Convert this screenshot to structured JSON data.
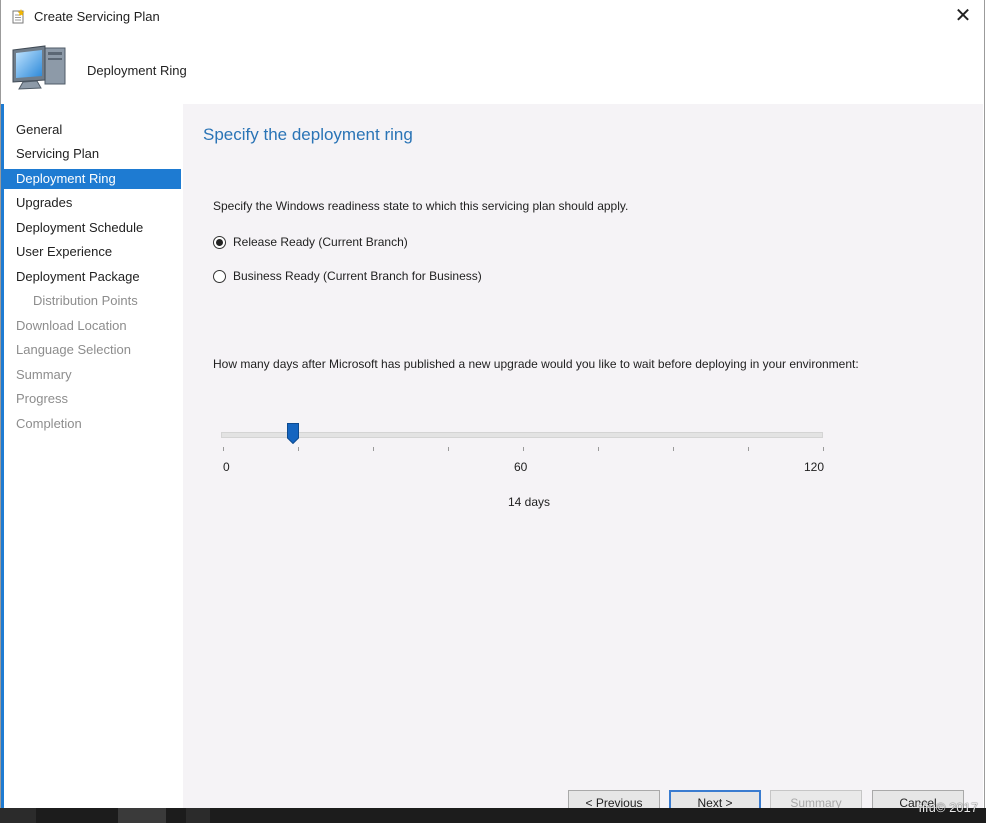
{
  "window": {
    "title": "Create Servicing Plan",
    "close_glyph": "✕"
  },
  "header": {
    "page_name": "Deployment Ring",
    "icon": "computer-monitor-icon"
  },
  "sidebar": {
    "items": [
      {
        "label": "General",
        "state": "normal"
      },
      {
        "label": "Servicing Plan",
        "state": "normal"
      },
      {
        "label": "Deployment Ring",
        "state": "selected"
      },
      {
        "label": "Upgrades",
        "state": "normal"
      },
      {
        "label": "Deployment Schedule",
        "state": "normal"
      },
      {
        "label": "User Experience",
        "state": "normal"
      },
      {
        "label": "Deployment Package",
        "state": "normal"
      },
      {
        "label": "Distribution Points",
        "state": "disabled-sub"
      },
      {
        "label": "Download Location",
        "state": "disabled"
      },
      {
        "label": "Language Selection",
        "state": "disabled"
      },
      {
        "label": "Summary",
        "state": "disabled"
      },
      {
        "label": "Progress",
        "state": "disabled"
      },
      {
        "label": "Completion",
        "state": "disabled"
      }
    ]
  },
  "main": {
    "title": "Specify the deployment ring",
    "instruction": "Specify the Windows readiness state to which this servicing plan should apply.",
    "options": [
      {
        "label": "Release Ready (Current Branch)",
        "checked": true
      },
      {
        "label": "Business Ready (Current Branch for Business)",
        "checked": false
      }
    ],
    "question": "How many days after Microsoft has published a new upgrade would you like to wait before deploying in your environment:",
    "slider": {
      "min": 0,
      "max": 120,
      "value": 14,
      "labels": [
        "0",
        "60",
        "120"
      ],
      "value_text": "14 days"
    }
  },
  "footer": {
    "previous_label": "< Previous",
    "next_label": "Next >",
    "summary_label": "Summary",
    "cancel_label": "Cancel"
  },
  "watermark": "fifu© 2017",
  "colors": {
    "accent": "#1e7bd2",
    "title_blue": "#2a74b6",
    "content_bg": "#f5f3f6"
  }
}
